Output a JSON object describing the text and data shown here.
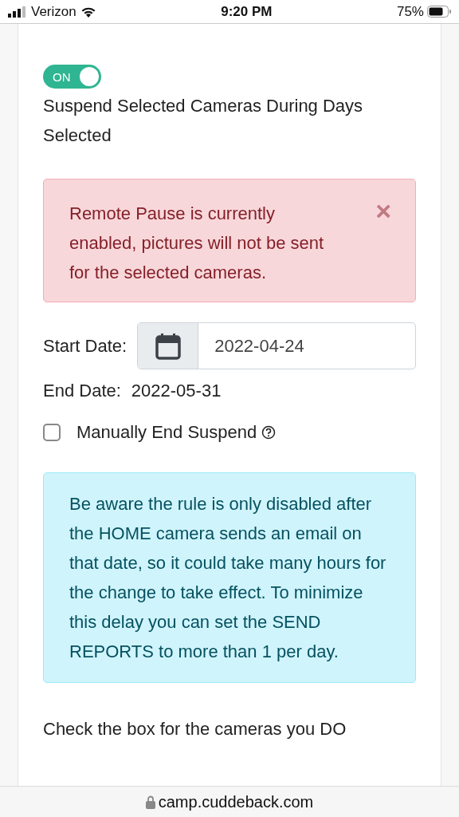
{
  "status_bar": {
    "carrier": "Verizon",
    "time": "9:20 PM",
    "battery": "75%"
  },
  "suspend_toggle": {
    "label": "ON",
    "on": true
  },
  "suspend_title": "Suspend Selected Cameras During Days Selected",
  "alert": {
    "message": "Remote Pause is currently enabled, pictures will not be sent for the selected cameras.",
    "close": "×"
  },
  "start_date": {
    "label": "Start Date:",
    "value": "2022-04-24"
  },
  "end_date": {
    "label": "End Date:",
    "value": "2022-05-31"
  },
  "manual_end": {
    "label": "Manually End Suspend",
    "checked": false
  },
  "info": "Be aware the rule is only disabled after the HOME camera sends an email on that date, so it could take many hours for the change to take effect. To minimize this delay you can set the SEND REPORTS to more than 1 per day.",
  "cameras_hint": "Check the box for the cameras you DO",
  "url_bar": {
    "url": "camp.cuddeback.com"
  }
}
